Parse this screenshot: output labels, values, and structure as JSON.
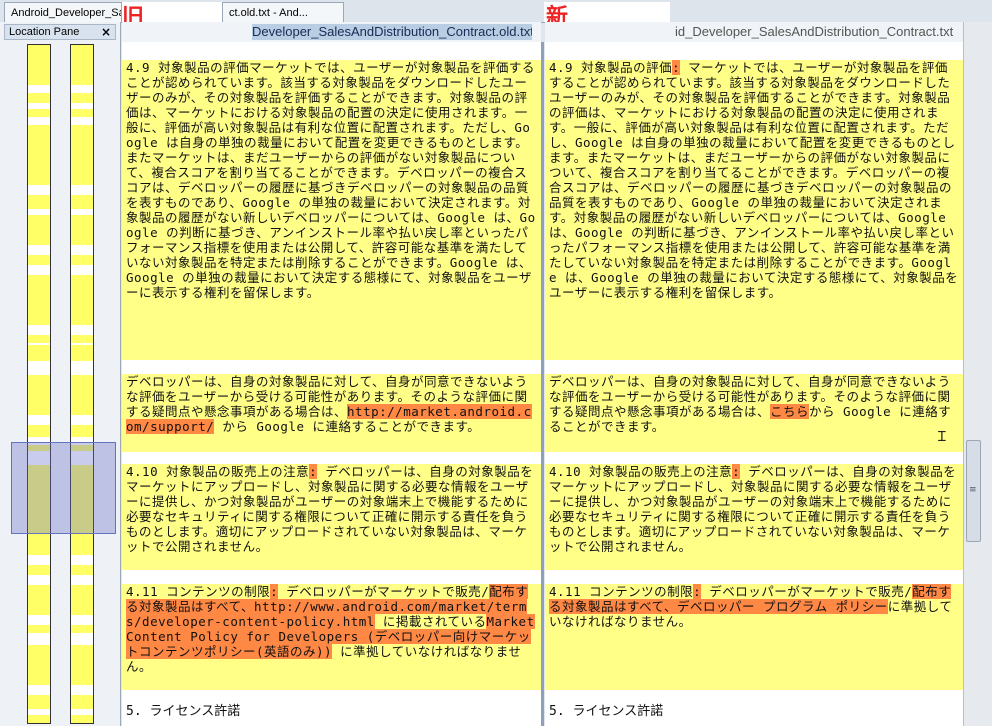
{
  "tabs": [
    {
      "label": "Android_Developer_Sa"
    },
    {
      "label": "ct.old.txt - And..."
    }
  ],
  "labels": {
    "old": "旧",
    "new": "新"
  },
  "location_pane": {
    "title": "Location Pane",
    "close": "×"
  },
  "headers": {
    "left_file": "Developer_SalesAndDistribution_Contract.old.txt",
    "right_file": "id_Developer_SalesAndDistribution_Contract.txt"
  },
  "left": {
    "b1": "4.9 対象製品の評価マーケットでは、ユーザーが対象製品を評価することが認められています。該当する対象製品をダウンロードしたユーザーのみが、その対象製品を評価することができます。対象製品の評価は、マーケットにおける対象製品の配置の決定に使用されます。一般に、評価が高い対象製品は有利な位置に配置されます。ただし、Google は自身の単独の裁量において配置を変更できるものとします。またマーケットは、まだユーザーからの評価がない対象製品について、複合スコアを割り当てることができます。デベロッパーの複合スコアは、デベロッパーの履歴に基づきデベロッパーの対象製品の品質を表すものであり、Google の単独の裁量において決定されます。対象製品の履歴がない新しいデベロッパーについては、Google は、Google の判断に基づき、アンインストール率や払い戻し率といったパフォーマンス指標を使用または公開して、許容可能な基準を満たしていない対象製品を特定または削除することができます。Google は、Google の単独の裁量において決定する態様にて、対象製品をユーザーに表示する権利を留保します。",
    "b2a": "デベロッパーは、自身の対象製品に対して、自身が同意できないような評価をユーザーから受ける可能性があります。そのような評価に関する疑問点や懸念事項がある場合は、",
    "b2diff": "http://market.android.com/support/",
    "b2b": " から Google に連絡することができます。",
    "b3a": "4.10 対象製品の販売上の注意",
    "b3diff": ":",
    "b3b": " デベロッパーは、自身の対象製品をマーケットにアップロードし、対象製品に関する必要な情報をユーザーに提供し、かつ対象製品がユーザーの対象端末上で機能するために必要なセキュリティに関する権限について正確に開示する責任を負うものとします。適切にアップロードされていない対象製品は、マーケットで公開されません。",
    "b4a": "4.11 コンテンツの制限",
    "b4d1": ":",
    "b4b": " デベロッパーがマーケットで販売/",
    "b4d2": "配布する対象製品はすべて",
    "b4d3": "、http://www.android.com/market/terms/developer-content-policy.html",
    "b4c": " に掲載されている",
    "b4d4": "Market Content Policy for Developers (デベロッパー向けマーケットコンテンツポリシー(英語のみ))",
    "b4e": " に準拠していなければなりません。",
    "b5": "5. ライセンス許諾"
  },
  "right": {
    "b1a": "4.9 対象製品の評価",
    "b1diff": ":",
    "b1b": " マーケットでは、ユーザーが対象製品を評価することが認められています。該当する対象製品をダウンロードしたユーザーのみが、その対象製品を評価することができます。対象製品の評価は、マーケットにおける対象製品の配置の決定に使用されます。一般に、評価が高い対象製品は有利な位置に配置されます。ただし、Google は自身の単独の裁量において配置を変更できるものとします。またマーケットは、まだユーザーからの評価がない対象製品について、複合スコアを割り当てることができます。デベロッパーの複合スコアは、デベロッパーの履歴に基づきデベロッパーの対象製品の品質を表すものであり、Google の単独の裁量において決定されます。対象製品の履歴がない新しいデベロッパーについては、Google は、Google の判断に基づき、アンインストール率や払い戻し率といったパフォーマンス指標を使用または公開して、許容可能な基準を満たしていない対象製品を特定または削除することができます。Google は、Google の単独の裁量において決定する態様にて、対象製品をユーザーに表示する権利を留保します。",
    "b2a": "デベロッパーは、自身の対象製品に対して、自身が同意できないような評価をユーザーから受ける可能性があります。そのような評価に関する疑問点や懸念事項がある場合は、",
    "b2diff": "こちら",
    "b2b": "から Google に連絡することができます。",
    "b3a": "4.10 対象製品の販売上の注意",
    "b3diff": ":",
    "b3b": " デベロッパーは、自身の対象製品をマーケットにアップロードし、対象製品に関する必要な情報をユーザーに提供し、かつ対象製品がユーザーの対象端末上で機能するために必要なセキュリティに関する権限について正確に開示する責任を負うものとします。適切にアップロードされていない対象製品は、マーケットで公開されません。",
    "b4a": "4.11 コンテンツの制限",
    "b4d1": ":",
    "b4b": " デベロッパーがマーケットで販売/",
    "b4d2": "配布する対象製品はすべて、デベロッパー プログラム ポリシー",
    "b4c": "に準拠していなければなりません。",
    "b5": "5. ライセンス許諾"
  },
  "colors": {
    "changed": "#ffff88",
    "diff": "#ff8844",
    "marker": "#ffff66"
  }
}
